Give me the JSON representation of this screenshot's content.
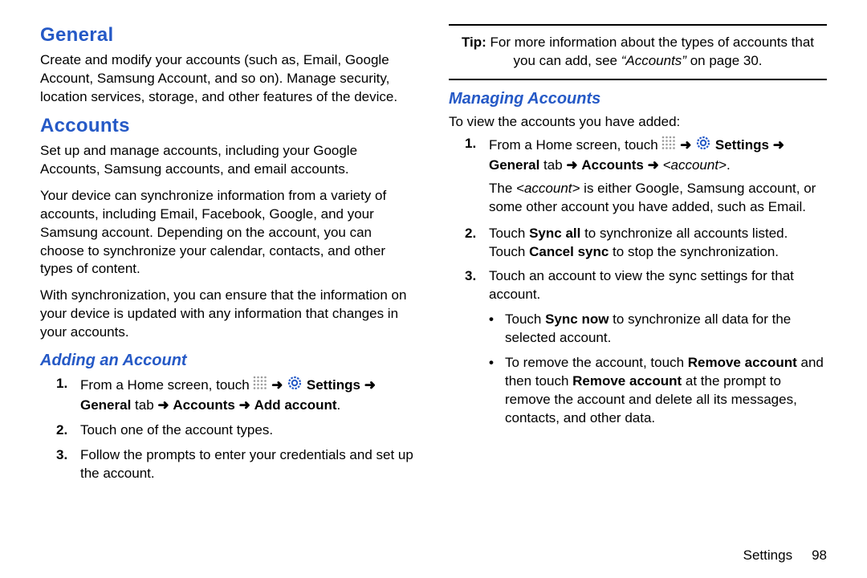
{
  "left": {
    "h_general": "General",
    "p_general": "Create and modify your accounts (such as, Email, Google Account, Samsung Account, and so on). Manage security, location services, storage, and other features of the device.",
    "h_accounts": "Accounts",
    "p_accounts_1": "Set up and manage accounts, including your Google Accounts, Samsung accounts, and email accounts.",
    "p_accounts_2": "Your device can synchronize information from a variety of accounts, including Email, Facebook, Google, and your Samsung account. Depending on the account, you can choose to synchronize your calendar, contacts, and other types of content.",
    "p_accounts_3": "With synchronization, you can ensure that the information on your device is updated with any information that changes in your accounts.",
    "h_adding": "Adding an Account",
    "step1_pre": "From a Home screen, touch",
    "settings_bold": "Settings",
    "step1_post_general": "General",
    "step1_post_tab": " tab ",
    "step1_post_accounts": "Accounts",
    "step1_post_addaccount": "Add account",
    "step2": "Touch one of the account types.",
    "step3": "Follow the prompts to enter your credentials and set up the account."
  },
  "right": {
    "tip_label": "Tip:",
    "tip_text_1": " For more information about the types of accounts that you can add, see ",
    "tip_text_ref": "“Accounts”",
    "tip_text_2": " on page 30.",
    "h_managing": "Managing Accounts",
    "p_managing_intro": "To view the accounts you have added:",
    "s1_pre": "From a Home screen, touch",
    "s1_settings": "Settings",
    "s1_general": "General",
    "s1_tab": " tab ",
    "s1_accounts": "Accounts",
    "s1_account_item": "<account>",
    "s1_followup_1": "The ",
    "s1_followup_item": "<account>",
    "s1_followup_2": " is either Google, Samsung account, or some other account you have added, such as Email.",
    "s2_a": "Touch ",
    "s2_syncall": "Sync all",
    "s2_b": " to synchronize all accounts listed. Touch ",
    "s2_cancel": "Cancel sync",
    "s2_c": " to stop the synchronization.",
    "s3": "Touch an account to view the sync settings for that account.",
    "b1_a": "Touch ",
    "b1_syncnow": "Sync now",
    "b1_b": " to synchronize all data for the selected account.",
    "b2_a": "To remove the account, touch ",
    "b2_remove": "Remove account",
    "b2_b": " and then touch ",
    "b2_remove2": "Remove account",
    "b2_c": " at the prompt to remove the account and delete all its messages, contacts, and other data."
  },
  "footer": {
    "label": "Settings",
    "page": "98"
  },
  "glyphs": {
    "arrow": "➜"
  }
}
